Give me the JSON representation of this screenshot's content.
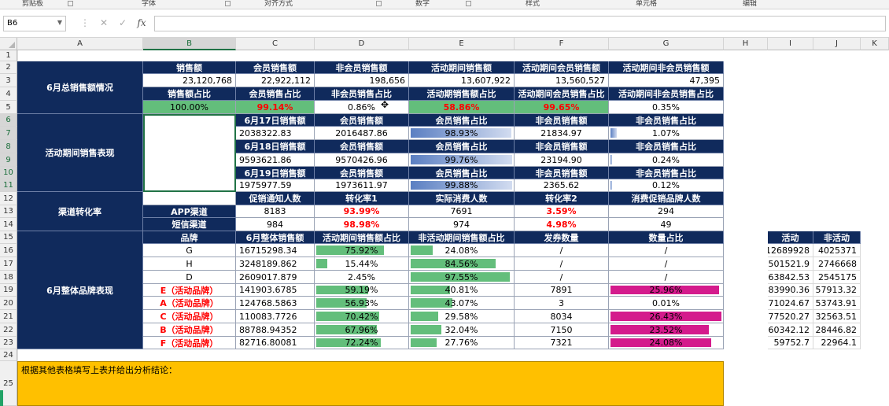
{
  "ribbon": {
    "groups": [
      "剪贴板",
      "字体",
      "对齐方式",
      "数字",
      "样式",
      "单元格",
      "编辑"
    ]
  },
  "formula_bar": {
    "name_box": "B6",
    "cancel_icon": "✕",
    "enter_icon": "✓",
    "fx_label": "fx",
    "formula": ""
  },
  "columns": [
    "A",
    "B",
    "C",
    "D",
    "E",
    "F",
    "G",
    "H",
    "I",
    "J",
    "K"
  ],
  "rows": [
    "1",
    "2",
    "3",
    "4",
    "5",
    "6",
    "7",
    "8",
    "9",
    "10",
    "11",
    "12",
    "13",
    "14",
    "15",
    "16",
    "17",
    "18",
    "19",
    "20",
    "21",
    "22",
    "23",
    "24",
    "25"
  ],
  "section_labels": {
    "total": "6月总销售额情况",
    "activity": "活动期间销售表现",
    "channel": "渠道转化率",
    "brand": "6月整体品牌表现"
  },
  "total": {
    "row2": [
      "销售额",
      "会员销售额",
      "非会员销售额",
      "活动期间销售额",
      "活动期间会员销售额",
      "活动期间非会员销售额"
    ],
    "row3": [
      "23,120,768",
      "22,922,112",
      "198,656",
      "13,607,922",
      "13,560,527",
      "47,395"
    ],
    "row4": [
      "销售额占比",
      "会员销售占比",
      "非会员销售占比",
      "活动期销售额占比",
      "活动期间会员销售占比",
      "活动期间非会员销售占比"
    ],
    "row5": [
      "100.00%",
      "99.14%",
      "0.86%",
      "58.86%",
      "99.65%",
      "0.35%"
    ]
  },
  "activity": {
    "days": [
      {
        "headers": [
          "6月17日销售额",
          "会员销售额",
          "会员销售占比",
          "非会员销售额",
          "非会员销售占比"
        ],
        "values": [
          "2038322.83",
          "2016487.86",
          "98.93%",
          "21834.97",
          "1.07%"
        ],
        "member_ratio": 0.9893,
        "nonmember_ratio": 0.0107
      },
      {
        "headers": [
          "6月18日销售额",
          "会员销售额",
          "会员销售占比",
          "非会员销售额",
          "非会员销售占比"
        ],
        "values": [
          "9593621.86",
          "9570426.96",
          "99.76%",
          "23194.90",
          "0.24%"
        ],
        "member_ratio": 0.9976,
        "nonmember_ratio": 0.0024
      },
      {
        "headers": [
          "6月19日销售额",
          "会员销售额",
          "会员销售占比",
          "非会员销售额",
          "非会员销售占比"
        ],
        "values": [
          "1975977.59",
          "1973611.97",
          "99.88%",
          "2365.62",
          "0.12%"
        ],
        "member_ratio": 0.9988,
        "nonmember_ratio": 0.0012
      }
    ]
  },
  "channel": {
    "headers": [
      "促销通知人数",
      "转化率1",
      "实际消费人数",
      "转化率2",
      "消费促销品牌人数"
    ],
    "rows": [
      {
        "name": "APP渠道",
        "values": [
          "8183",
          "93.99%",
          "7691",
          "3.59%",
          "294"
        ]
      },
      {
        "name": "短信渠道",
        "values": [
          "984",
          "98.98%",
          "974",
          "4.98%",
          "49"
        ]
      }
    ]
  },
  "brand": {
    "headers": [
      "品牌",
      "6月整体销售额",
      "活动期间销售额占比",
      "非活动期间销售额占比",
      "发券数量",
      "数量占比"
    ],
    "rows": [
      {
        "name": "G",
        "red": false,
        "sales": "16715298.34",
        "act": "75.92%",
        "act_r": 0.7592,
        "nonact": "24.08%",
        "nonact_r": 0.2408,
        "coupon": "/",
        "share": "/",
        "share_r": 0
      },
      {
        "name": "H",
        "red": false,
        "sales": "3248189.862",
        "act": "15.44%",
        "act_r": 0.1544,
        "nonact": "84.56%",
        "nonact_r": 0.8456,
        "coupon": "/",
        "share": "/",
        "share_r": 0
      },
      {
        "name": "D",
        "red": false,
        "sales": "2609017.879",
        "act": "2.45%",
        "act_r": 0.0245,
        "nonact": "97.55%",
        "nonact_r": 0.9755,
        "coupon": "/",
        "share": "/",
        "share_r": 0
      },
      {
        "name": "E（活动品牌）",
        "red": true,
        "sales": "141903.6785",
        "act": "59.19%",
        "act_r": 0.5919,
        "nonact": "40.81%",
        "nonact_r": 0.4081,
        "coupon": "7891",
        "share": "25.96%",
        "share_r": 0.2596
      },
      {
        "name": "A（活动品牌）",
        "red": true,
        "sales": "124768.5863",
        "act": "56.93%",
        "act_r": 0.5693,
        "nonact": "43.07%",
        "nonact_r": 0.4307,
        "coupon": "3",
        "share": "0.01%",
        "share_r": 0.0001
      },
      {
        "name": "C（活动品牌）",
        "red": true,
        "sales": "110083.7726",
        "act": "70.42%",
        "act_r": 0.7042,
        "nonact": "29.58%",
        "nonact_r": 0.2958,
        "coupon": "8034",
        "share": "26.43%",
        "share_r": 0.2643
      },
      {
        "name": "B（活动品牌）",
        "red": true,
        "sales": "88788.94352",
        "act": "67.96%",
        "act_r": 0.6796,
        "nonact": "32.04%",
        "nonact_r": 0.3204,
        "coupon": "7150",
        "share": "23.52%",
        "share_r": 0.2352
      },
      {
        "name": "F（活动品牌）",
        "red": true,
        "sales": "82716.80081",
        "act": "72.24%",
        "act_r": 0.7224,
        "nonact": "27.76%",
        "nonact_r": 0.2776,
        "coupon": "7321",
        "share": "24.08%",
        "share_r": 0.2408
      }
    ]
  },
  "side_table": {
    "headers": [
      "活动",
      "非活动"
    ],
    "rows": [
      [
        "12689928",
        "4025371"
      ],
      [
        "501521.9",
        "2746668"
      ],
      [
        "63842.53",
        "2545175"
      ],
      [
        "83990.36",
        "57913.32"
      ],
      [
        "71024.67",
        "53743.91"
      ],
      [
        "77520.27",
        "32563.51"
      ],
      [
        "60342.12",
        "28446.82"
      ],
      [
        "59752.7",
        "22964.1"
      ]
    ]
  },
  "note": "根据其他表格填写上表并给出分析结论：",
  "colors": {
    "header_bg": "#102a5c",
    "green_fill": "#63be7b",
    "pink_fill": "#d41b8c",
    "note_bg": "#ffc000",
    "red_text": "#ff0000"
  }
}
